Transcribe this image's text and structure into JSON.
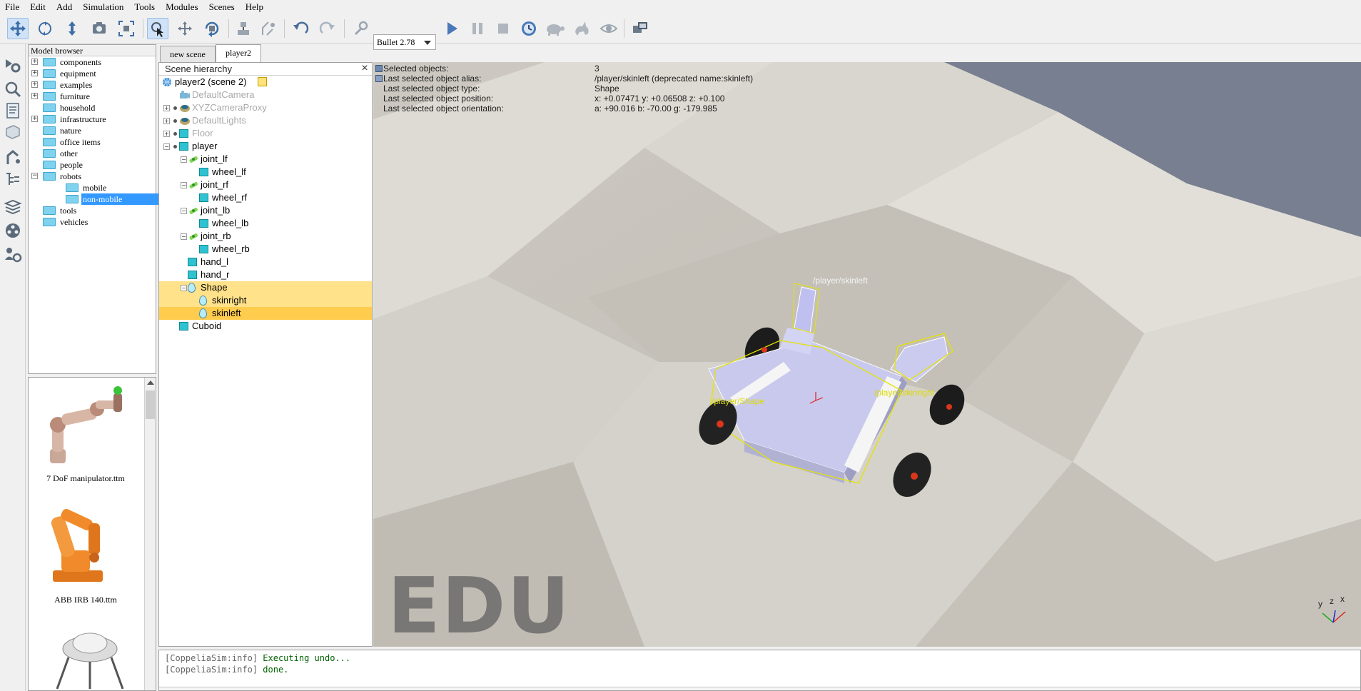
{
  "menu": [
    "File",
    "Edit",
    "Add",
    "Simulation",
    "Tools",
    "Modules",
    "Scenes",
    "Help"
  ],
  "toolbar": {
    "engine_value": "Bullet 2.78",
    "icons": [
      "move-camera-icon",
      "rotate-camera-icon",
      "shift-camera-icon",
      "camera-angle-icon",
      "fit-to-view-icon",
      "click-select-icon",
      "object-shift-icon",
      "object-rotate-icon",
      "assemble-icon",
      "transfer-dna-icon",
      "undo-icon",
      "redo-icon",
      "simulation-settings-icon",
      "start-simulation-icon",
      "pause-simulation-icon",
      "stop-simulation-icon",
      "realtime-icon",
      "slow-down-icon",
      "speed-up-icon",
      "visualization-icon",
      "page-selector-icon"
    ]
  },
  "model_browser": {
    "title": "Model browser",
    "items": [
      {
        "label": "components",
        "expandable": true,
        "level": 0
      },
      {
        "label": "equipment",
        "expandable": true,
        "level": 0
      },
      {
        "label": "examples",
        "expandable": true,
        "level": 0
      },
      {
        "label": "furniture",
        "expandable": true,
        "level": 0
      },
      {
        "label": "household",
        "expandable": false,
        "level": 0
      },
      {
        "label": "infrastructure",
        "expandable": true,
        "level": 0
      },
      {
        "label": "nature",
        "expandable": false,
        "level": 0
      },
      {
        "label": "office items",
        "expandable": false,
        "level": 0
      },
      {
        "label": "other",
        "expandable": false,
        "level": 0
      },
      {
        "label": "people",
        "expandable": false,
        "level": 0
      },
      {
        "label": "robots",
        "expandable": true,
        "expanded": true,
        "level": 0
      },
      {
        "label": "mobile",
        "expandable": false,
        "level": 1
      },
      {
        "label": "non-mobile",
        "expandable": false,
        "level": 1,
        "selected": true
      },
      {
        "label": "tools",
        "expandable": false,
        "level": 0
      },
      {
        "label": "vehicles",
        "expandable": false,
        "level": 0
      }
    ],
    "thumbnails": [
      "7 DoF manipulator.ttm",
      "ABB IRB 140.ttm"
    ]
  },
  "tabs": [
    {
      "label": "new scene",
      "active": false
    },
    {
      "label": "player2",
      "active": true
    }
  ],
  "hierarchy": {
    "title": "Scene hierarchy",
    "close": "×",
    "rows": [
      {
        "label": "player2 (scene 2)",
        "icon": "globe",
        "indent": 0,
        "dim": false
      },
      {
        "label": "DefaultCamera",
        "icon": "camera",
        "indent": 1,
        "dim": true
      },
      {
        "label": "XYZCameraProxy",
        "icon": "dummy",
        "indent": 1,
        "dim": true,
        "exp": true
      },
      {
        "label": "DefaultLights",
        "icon": "dummy",
        "indent": 1,
        "dim": true,
        "exp": true
      },
      {
        "label": "Floor",
        "icon": "cube",
        "indent": 1,
        "dim": true,
        "exp": true
      },
      {
        "label": "player",
        "icon": "cube",
        "indent": 1,
        "dim": false,
        "exp": true,
        "open": true
      },
      {
        "label": "joint_lf",
        "icon": "joint",
        "indent": 2,
        "dim": false,
        "exp": true,
        "open": true
      },
      {
        "label": "wheel_lf",
        "icon": "cube",
        "indent": 3,
        "dim": false
      },
      {
        "label": "joint_rf",
        "icon": "joint",
        "indent": 2,
        "dim": false,
        "exp": true,
        "open": true
      },
      {
        "label": "wheel_rf",
        "icon": "cube",
        "indent": 3,
        "dim": false
      },
      {
        "label": "joint_lb",
        "icon": "joint",
        "indent": 2,
        "dim": false,
        "exp": true,
        "open": true
      },
      {
        "label": "wheel_lb",
        "icon": "cube",
        "indent": 3,
        "dim": false
      },
      {
        "label": "joint_rb",
        "icon": "joint",
        "indent": 2,
        "dim": false,
        "exp": true,
        "open": true
      },
      {
        "label": "wheel_rb",
        "icon": "cube",
        "indent": 3,
        "dim": false
      },
      {
        "label": "hand_l",
        "icon": "cube",
        "indent": 2,
        "dim": false
      },
      {
        "label": "hand_r",
        "icon": "cube",
        "indent": 2,
        "dim": false
      },
      {
        "label": "Shape",
        "icon": "drop",
        "indent": 2,
        "dim": false,
        "exp": true,
        "open": true,
        "sel": 1
      },
      {
        "label": "skinright",
        "icon": "drop",
        "indent": 3,
        "dim": false,
        "sel": 1
      },
      {
        "label": "skinleft",
        "icon": "drop",
        "indent": 3,
        "dim": false,
        "sel": 2
      },
      {
        "label": "Cuboid",
        "icon": "cube",
        "indent": 1,
        "dim": false
      }
    ]
  },
  "selection_info": [
    {
      "label": "Selected objects:",
      "value": "3"
    },
    {
      "label": "Last selected object alias:",
      "value": "/player/skinleft   (deprecated name:skinleft)"
    },
    {
      "label": "Last selected object type:",
      "value": "Shape"
    },
    {
      "label": "Last selected object position:",
      "value": "x: +0.07471    y: +0.06508    z: +0.100"
    },
    {
      "label": "Last selected object orientation:",
      "value": "a: +90.016    b: -70.00    g: -179.985"
    }
  ],
  "viewport": {
    "watermark": "EDU",
    "label_skinleft": "/player/skinleft",
    "label_shape": "/player/Shape",
    "label_skinright": "/player/skinright",
    "axis_x": "x",
    "axis_y": "y",
    "axis_z": "z"
  },
  "console": [
    {
      "prefix": "[CoppeliaSim:info]",
      "message": "Executing undo..."
    },
    {
      "prefix": "[CoppeliaSim:info]",
      "message": "done."
    }
  ]
}
